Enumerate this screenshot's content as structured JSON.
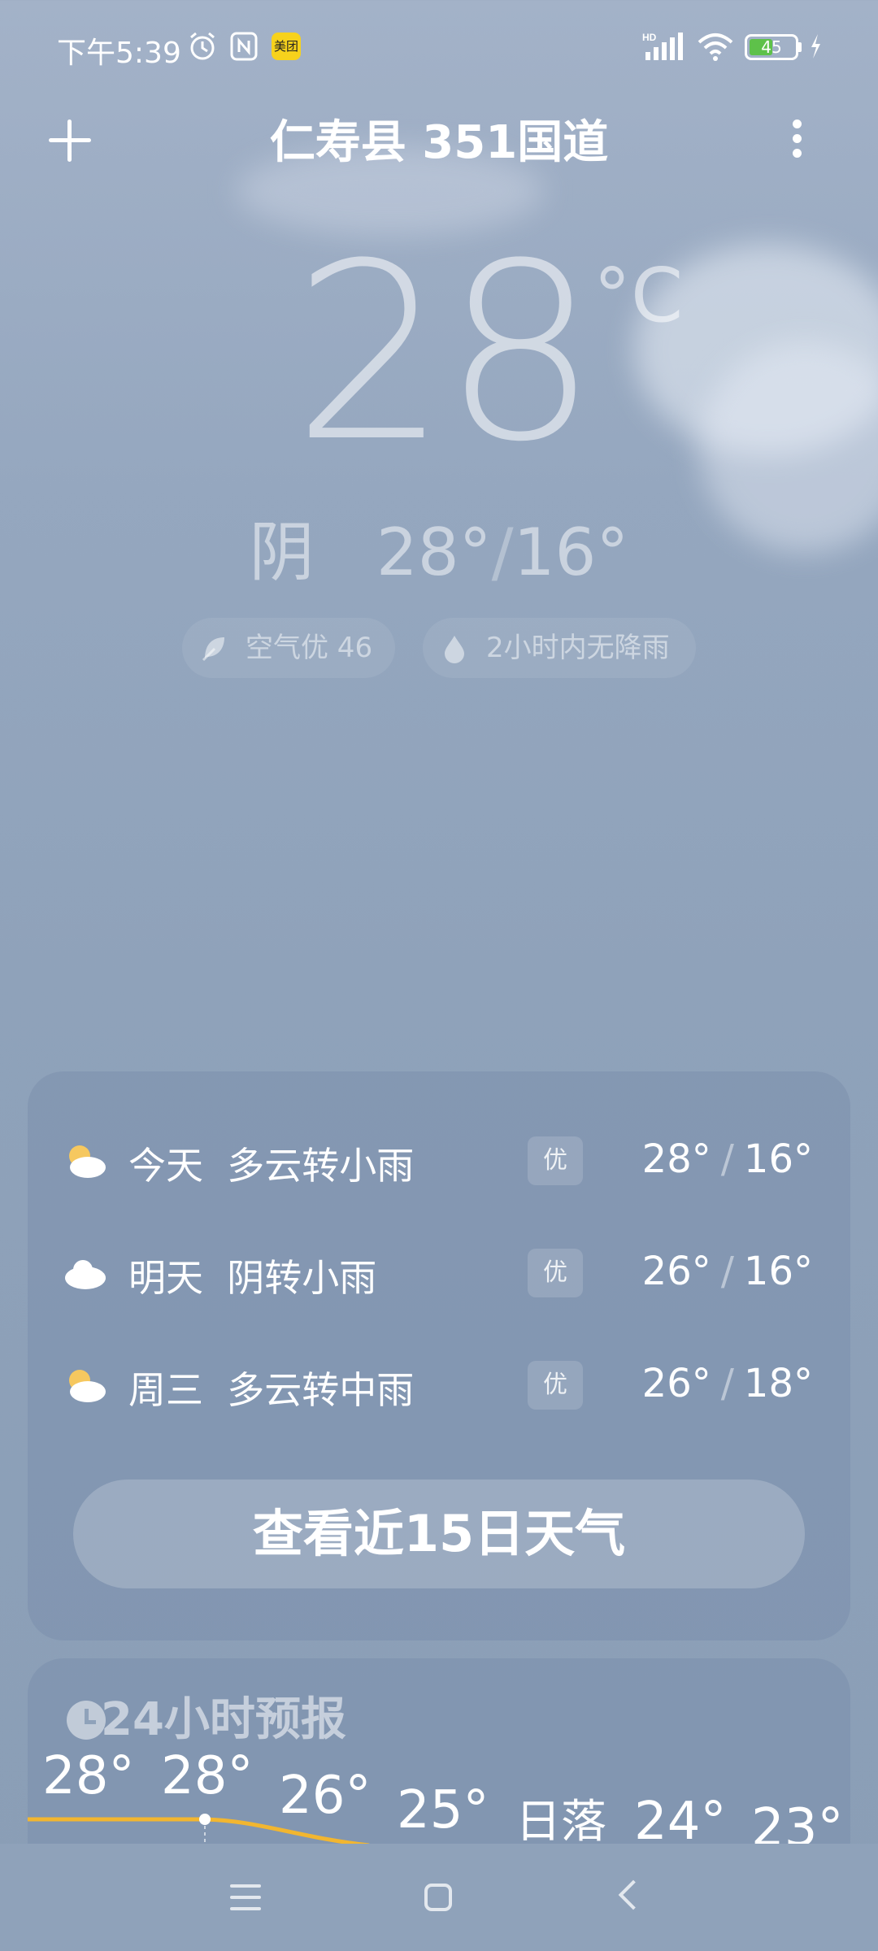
{
  "status_bar": {
    "time": "下午5:39",
    "battery": "45",
    "icons": [
      "alarm-icon",
      "nfc-icon",
      "meituan-icon",
      "signal-icon",
      "wifi-icon",
      "battery-icon",
      "charging-icon"
    ]
  },
  "header": {
    "title": "仁寿县 351国道"
  },
  "current": {
    "temperature": "28",
    "unit": "°C",
    "condition": "阴",
    "high": "28°",
    "low": "16°",
    "air_quality": "空气优 46",
    "rain": "2小时内无降雨"
  },
  "forecast": [
    {
      "day": "今天",
      "condition": "多云转小雨",
      "badge": "优",
      "high": "28°",
      "low": "16°",
      "icon": "partly-cloudy-icon"
    },
    {
      "day": "明天",
      "condition": "阴转小雨",
      "badge": "优",
      "high": "26°",
      "low": "16°",
      "icon": "cloudy-icon"
    },
    {
      "day": "周三",
      "condition": "多云转中雨",
      "badge": "优",
      "high": "26°",
      "low": "18°",
      "icon": "partly-cloudy-icon"
    }
  ],
  "forecast_button": "查看近15日天气",
  "hourly": {
    "title": "24小时预报",
    "temps": [
      "28°",
      "28°",
      "26°",
      "25°",
      "日落",
      "24°",
      "23°"
    ]
  },
  "colors": {
    "accent_line": "#f2b630",
    "sun": "#f6c85f"
  }
}
